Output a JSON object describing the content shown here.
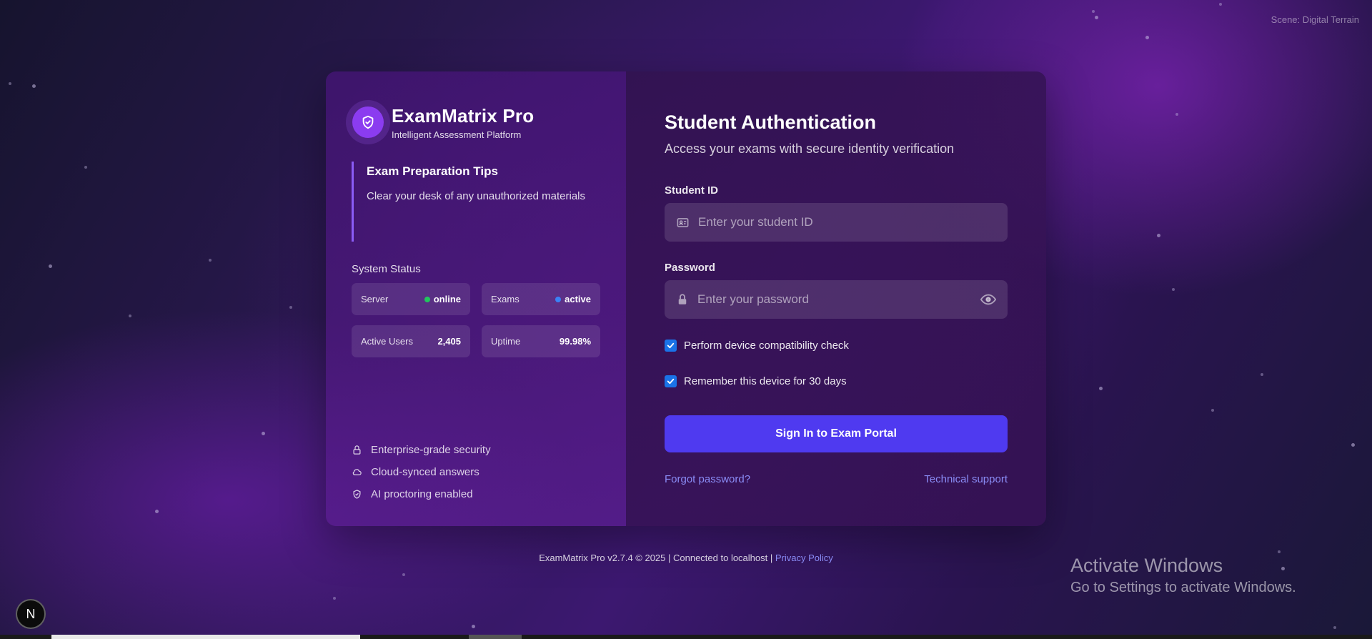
{
  "scene_label": "Scene: Digital Terrain",
  "brand": {
    "title": "ExamMatrix Pro",
    "subtitle": "Intelligent Assessment Platform",
    "logo_icon": "shield-check-icon"
  },
  "tips": {
    "title": "Exam Preparation Tips",
    "body": "Clear your desk of any unauthorized materials"
  },
  "system_status": {
    "title": "System Status",
    "items": [
      {
        "label": "Server",
        "value": "online",
        "dot_color": "#22c55e"
      },
      {
        "label": "Exams",
        "value": "active",
        "dot_color": "#3b82f6"
      },
      {
        "label": "Active Users",
        "value": "2,405"
      },
      {
        "label": "Uptime",
        "value": "99.98%"
      }
    ]
  },
  "features": [
    {
      "icon": "lock-icon",
      "label": "Enterprise-grade security"
    },
    {
      "icon": "cloud-icon",
      "label": "Cloud-synced answers"
    },
    {
      "icon": "shield-check-icon",
      "label": "AI proctoring enabled"
    }
  ],
  "auth": {
    "title": "Student Authentication",
    "subtitle": "Access your exams with secure identity verification",
    "student_id": {
      "label": "Student ID",
      "placeholder": "Enter your student ID",
      "value": ""
    },
    "password": {
      "label": "Password",
      "placeholder": "Enter your password",
      "value": ""
    },
    "checks": [
      {
        "label": "Perform device compatibility check",
        "checked": true
      },
      {
        "label": "Remember this device for 30 days",
        "checked": true
      }
    ],
    "submit_label": "Sign In to Exam Portal",
    "forgot_label": "Forgot password?",
    "support_label": "Technical support"
  },
  "footer": {
    "text": "ExamMatrix Pro v2.7.4 © 2025 | Connected to localhost |",
    "privacy_label": "Privacy Policy"
  },
  "activate_windows": {
    "line1": "Activate Windows",
    "line2": "Go to Settings to activate Windows."
  },
  "corner_badge": "N",
  "colors": {
    "accent": "#4f3af0",
    "brand_logo": "#8b3cf0",
    "link": "#8a8cf5",
    "tip_bar": "#8b5cf6"
  }
}
